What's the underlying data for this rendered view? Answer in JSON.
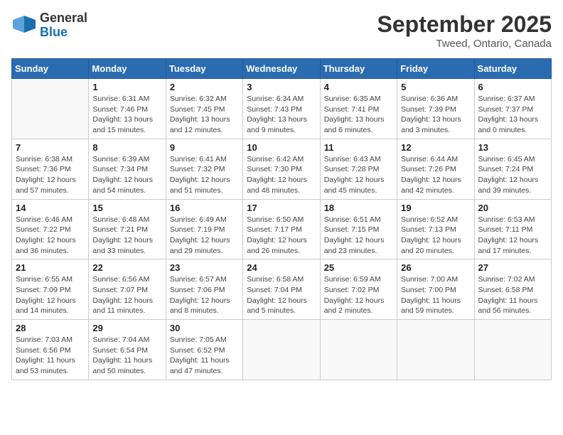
{
  "header": {
    "logo_line1": "General",
    "logo_line2": "Blue",
    "month": "September 2025",
    "location": "Tweed, Ontario, Canada"
  },
  "weekdays": [
    "Sunday",
    "Monday",
    "Tuesday",
    "Wednesday",
    "Thursday",
    "Friday",
    "Saturday"
  ],
  "weeks": [
    [
      {
        "day": "",
        "info": ""
      },
      {
        "day": "1",
        "info": "Sunrise: 6:31 AM\nSunset: 7:46 PM\nDaylight: 13 hours\nand 15 minutes."
      },
      {
        "day": "2",
        "info": "Sunrise: 6:32 AM\nSunset: 7:45 PM\nDaylight: 13 hours\nand 12 minutes."
      },
      {
        "day": "3",
        "info": "Sunrise: 6:34 AM\nSunset: 7:43 PM\nDaylight: 13 hours\nand 9 minutes."
      },
      {
        "day": "4",
        "info": "Sunrise: 6:35 AM\nSunset: 7:41 PM\nDaylight: 13 hours\nand 6 minutes."
      },
      {
        "day": "5",
        "info": "Sunrise: 6:36 AM\nSunset: 7:39 PM\nDaylight: 13 hours\nand 3 minutes."
      },
      {
        "day": "6",
        "info": "Sunrise: 6:37 AM\nSunset: 7:37 PM\nDaylight: 13 hours\nand 0 minutes."
      }
    ],
    [
      {
        "day": "7",
        "info": "Sunrise: 6:38 AM\nSunset: 7:36 PM\nDaylight: 12 hours\nand 57 minutes."
      },
      {
        "day": "8",
        "info": "Sunrise: 6:39 AM\nSunset: 7:34 PM\nDaylight: 12 hours\nand 54 minutes."
      },
      {
        "day": "9",
        "info": "Sunrise: 6:41 AM\nSunset: 7:32 PM\nDaylight: 12 hours\nand 51 minutes."
      },
      {
        "day": "10",
        "info": "Sunrise: 6:42 AM\nSunset: 7:30 PM\nDaylight: 12 hours\nand 48 minutes."
      },
      {
        "day": "11",
        "info": "Sunrise: 6:43 AM\nSunset: 7:28 PM\nDaylight: 12 hours\nand 45 minutes."
      },
      {
        "day": "12",
        "info": "Sunrise: 6:44 AM\nSunset: 7:26 PM\nDaylight: 12 hours\nand 42 minutes."
      },
      {
        "day": "13",
        "info": "Sunrise: 6:45 AM\nSunset: 7:24 PM\nDaylight: 12 hours\nand 39 minutes."
      }
    ],
    [
      {
        "day": "14",
        "info": "Sunrise: 6:46 AM\nSunset: 7:22 PM\nDaylight: 12 hours\nand 36 minutes."
      },
      {
        "day": "15",
        "info": "Sunrise: 6:48 AM\nSunset: 7:21 PM\nDaylight: 12 hours\nand 33 minutes."
      },
      {
        "day": "16",
        "info": "Sunrise: 6:49 AM\nSunset: 7:19 PM\nDaylight: 12 hours\nand 29 minutes."
      },
      {
        "day": "17",
        "info": "Sunrise: 6:50 AM\nSunset: 7:17 PM\nDaylight: 12 hours\nand 26 minutes."
      },
      {
        "day": "18",
        "info": "Sunrise: 6:51 AM\nSunset: 7:15 PM\nDaylight: 12 hours\nand 23 minutes."
      },
      {
        "day": "19",
        "info": "Sunrise: 6:52 AM\nSunset: 7:13 PM\nDaylight: 12 hours\nand 20 minutes."
      },
      {
        "day": "20",
        "info": "Sunrise: 6:53 AM\nSunset: 7:11 PM\nDaylight: 12 hours\nand 17 minutes."
      }
    ],
    [
      {
        "day": "21",
        "info": "Sunrise: 6:55 AM\nSunset: 7:09 PM\nDaylight: 12 hours\nand 14 minutes."
      },
      {
        "day": "22",
        "info": "Sunrise: 6:56 AM\nSunset: 7:07 PM\nDaylight: 12 hours\nand 11 minutes."
      },
      {
        "day": "23",
        "info": "Sunrise: 6:57 AM\nSunset: 7:06 PM\nDaylight: 12 hours\nand 8 minutes."
      },
      {
        "day": "24",
        "info": "Sunrise: 6:58 AM\nSunset: 7:04 PM\nDaylight: 12 hours\nand 5 minutes."
      },
      {
        "day": "25",
        "info": "Sunrise: 6:59 AM\nSunset: 7:02 PM\nDaylight: 12 hours\nand 2 minutes."
      },
      {
        "day": "26",
        "info": "Sunrise: 7:00 AM\nSunset: 7:00 PM\nDaylight: 11 hours\nand 59 minutes."
      },
      {
        "day": "27",
        "info": "Sunrise: 7:02 AM\nSunset: 6:58 PM\nDaylight: 11 hours\nand 56 minutes."
      }
    ],
    [
      {
        "day": "28",
        "info": "Sunrise: 7:03 AM\nSunset: 6:56 PM\nDaylight: 11 hours\nand 53 minutes."
      },
      {
        "day": "29",
        "info": "Sunrise: 7:04 AM\nSunset: 6:54 PM\nDaylight: 11 hours\nand 50 minutes."
      },
      {
        "day": "30",
        "info": "Sunrise: 7:05 AM\nSunset: 6:52 PM\nDaylight: 11 hours\nand 47 minutes."
      },
      {
        "day": "",
        "info": ""
      },
      {
        "day": "",
        "info": ""
      },
      {
        "day": "",
        "info": ""
      },
      {
        "day": "",
        "info": ""
      }
    ]
  ]
}
